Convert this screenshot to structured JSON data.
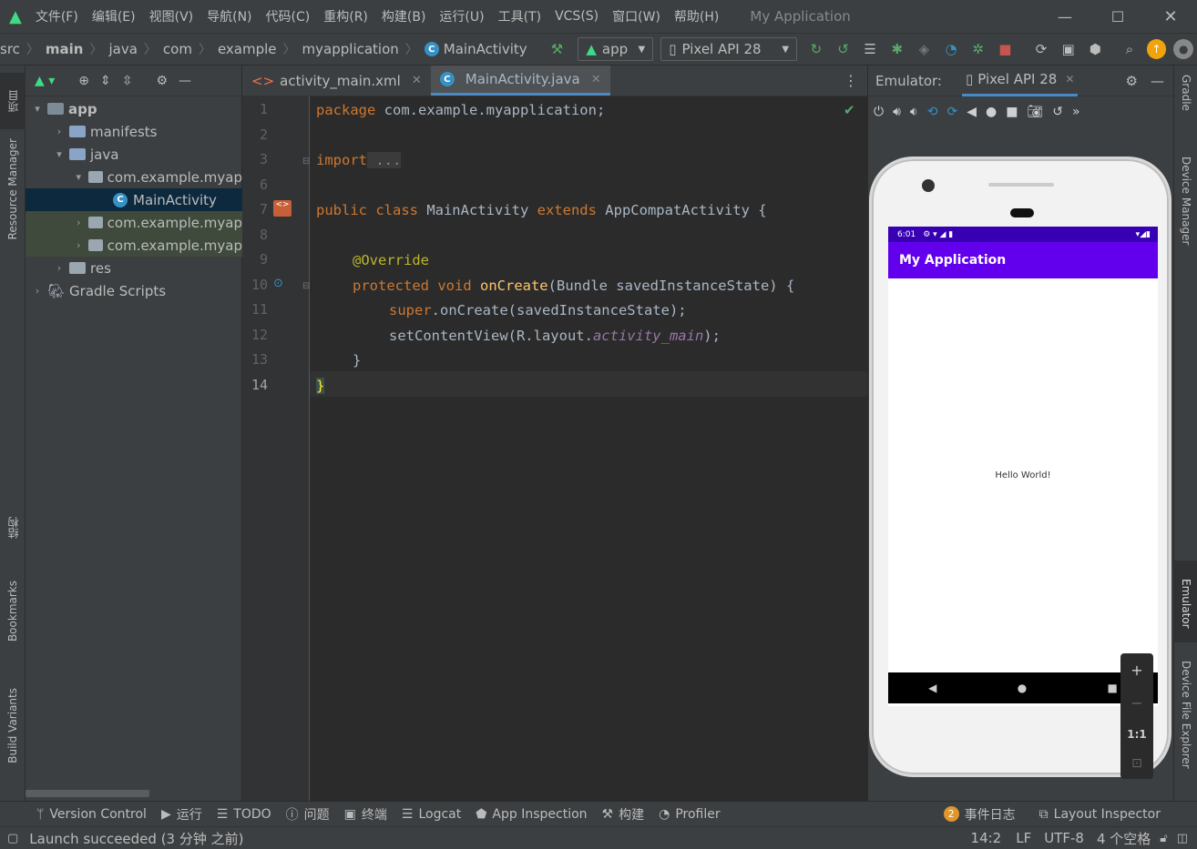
{
  "menu": [
    "文件(F)",
    "编辑(E)",
    "视图(V)",
    "导航(N)",
    "代码(C)",
    "重构(R)",
    "构建(B)",
    "运行(U)",
    "工具(T)",
    "VCS(S)",
    "窗口(W)",
    "帮助(H)"
  ],
  "window_title": "My Application",
  "breadcrumbs": [
    "src",
    "main",
    "java",
    "com",
    "example",
    "myapplication",
    "MainActivity"
  ],
  "run_config": "app",
  "device": "Pixel API 28",
  "left_tabs": [
    "项目",
    "Resource Manager",
    "结构",
    "Bookmarks",
    "Build Variants"
  ],
  "right_tabs": [
    "Gradle",
    "Device Manager",
    "Emulator",
    "Device File Explorer"
  ],
  "project_tree": [
    {
      "label": "app",
      "indent": 0,
      "expanded": true,
      "kind": "module"
    },
    {
      "label": "manifests",
      "indent": 1,
      "expanded": false,
      "kind": "folder"
    },
    {
      "label": "java",
      "indent": 1,
      "expanded": true,
      "kind": "folder"
    },
    {
      "label": "com.example.myap",
      "indent": 2,
      "expanded": true,
      "kind": "package"
    },
    {
      "label": "MainActivity",
      "indent": 3,
      "expanded": null,
      "kind": "class"
    },
    {
      "label": "com.example.myap",
      "indent": 2,
      "expanded": false,
      "kind": "package"
    },
    {
      "label": "com.example.myap",
      "indent": 2,
      "expanded": false,
      "kind": "package"
    },
    {
      "label": "res",
      "indent": 1,
      "expanded": false,
      "kind": "folder"
    },
    {
      "label": "Gradle Scripts",
      "indent": 0,
      "expanded": false,
      "kind": "gradle"
    }
  ],
  "editor_tabs": [
    {
      "label": "activity_main.xml",
      "active": false
    },
    {
      "label": "MainActivity.java",
      "active": true
    }
  ],
  "line_numbers": [
    "1",
    "2",
    "3",
    "6",
    "7",
    "8",
    "9",
    "10",
    "11",
    "12",
    "13",
    "14"
  ],
  "code": {
    "l1_kw": "package",
    "l1_rest": " com.example.myapplication;",
    "l3_kw": "import",
    "l3_rest": " ...",
    "l7_kw1": "public class",
    "l7_name": " MainActivity ",
    "l7_kw2": "extends",
    "l7_rest": " AppCompatActivity {",
    "l9_an": "@Override",
    "l10_kw": "protected void",
    "l10_fn": " onCreate",
    "l10_rest": "(Bundle savedInstanceState) {",
    "l11_kw": "super",
    "l11_rest": ".onCreate(savedInstanceState);",
    "l12_a": "setContentView(R.layout.",
    "l12_fld": "activity_main",
    "l12_b": ");",
    "l13": "}",
    "l14": "}"
  },
  "emulator": {
    "title": "Emulator:",
    "tab": "Pixel API 28",
    "status_time": "6:01",
    "app_title": "My Application",
    "content": "Hello World!",
    "zoom_ratio": "1:1"
  },
  "bottom_tools": [
    "Version Control",
    "运行",
    "TODO",
    "问题",
    "终端",
    "Logcat",
    "App Inspection",
    "构建",
    "Profiler"
  ],
  "event_log": {
    "count": "2",
    "label": "事件日志"
  },
  "layout_inspector": "Layout Inspector",
  "status": {
    "message": "Launch succeeded (3 分钟 之前)",
    "position": "14:2",
    "line_sep": "LF",
    "encoding": "UTF-8",
    "indent": "4 个空格"
  }
}
